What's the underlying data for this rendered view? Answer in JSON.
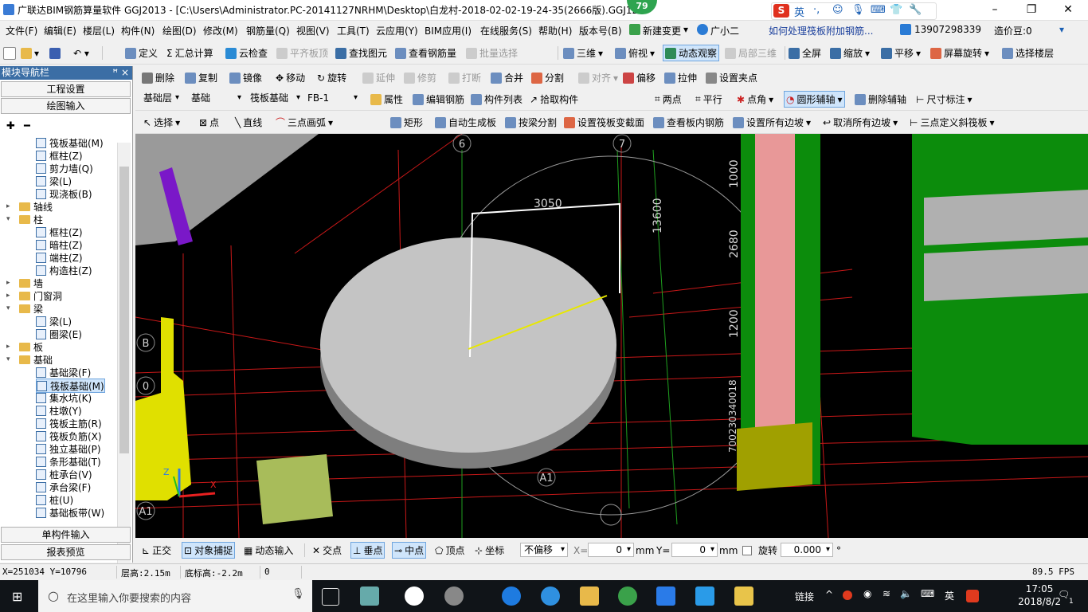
{
  "window": {
    "title": "广联达BIM钢筋算量软件 GGJ2013 - [C:\\Users\\Administrator.PC-20141127NRHM\\Desktop\\白龙村-2018-02-02-19-24-35(2666版).GGJ12",
    "badge": "79",
    "ime": {
      "lang": "英"
    }
  },
  "menu": [
    "文件(F)",
    "编辑(E)",
    "楼层(L)",
    "构件(N)",
    "绘图(D)",
    "修改(M)",
    "钢筋量(Q)",
    "视图(V)",
    "工具(T)",
    "云应用(Y)",
    "BIM应用(I)",
    "在线服务(S)",
    "帮助(H)",
    "版本号(B)",
    "新建变更",
    "广小二"
  ],
  "menu_right": {
    "question": "如何处理筏板附加钢筋...",
    "phone": "13907298339",
    "points": "造价豆:0"
  },
  "toolbar1": [
    "定义",
    "汇总计算",
    "云检查",
    "平齐板顶",
    "查找图元",
    "查看钢筋量",
    "批量选择",
    "三维",
    "俯视",
    "动态观察",
    "局部三维",
    "全屏",
    "缩放",
    "平移",
    "屏幕旋转",
    "选择楼层"
  ],
  "toolbar2": [
    "删除",
    "复制",
    "镜像",
    "移动",
    "旋转",
    "延伸",
    "修剪",
    "打断",
    "合并",
    "分割",
    "对齐",
    "偏移",
    "拉伸",
    "设置夹点"
  ],
  "toolbar3": {
    "floor_type": "基础层",
    "floor": "基础",
    "category": "筏板基础",
    "component": "FB-1",
    "buttons": [
      "属性",
      "编辑钢筋",
      "构件列表",
      "拾取构件"
    ],
    "snap_buttons": [
      "两点",
      "平行",
      "点角",
      "圆形辅轴",
      "删除辅轴",
      "尺寸标注"
    ]
  },
  "toolbar4": [
    "选择",
    "点",
    "直线",
    "三点画弧",
    "矩形",
    "自动生成板",
    "按梁分割",
    "设置筏板变截面",
    "查看板内钢筋",
    "设置所有边坡",
    "取消所有边坡",
    "三点定义斜筏板"
  ],
  "nav": {
    "header": "模块导航栏",
    "pin": "ꟸ ×",
    "top_buttons": [
      "工程设置",
      "绘图输入"
    ],
    "tree": [
      {
        "label": "筏板基础(M)",
        "level": 2
      },
      {
        "label": "框柱(Z)",
        "level": 2
      },
      {
        "label": "剪力墙(Q)",
        "level": 2
      },
      {
        "label": "梁(L)",
        "level": 2
      },
      {
        "label": "现浇板(B)",
        "level": 2
      },
      {
        "label": "轴线",
        "level": 1,
        "exp": "+"
      },
      {
        "label": "柱",
        "level": 1,
        "exp": "−"
      },
      {
        "label": "框柱(Z)",
        "level": 2
      },
      {
        "label": "暗柱(Z)",
        "level": 2
      },
      {
        "label": "端柱(Z)",
        "level": 2
      },
      {
        "label": "构造柱(Z)",
        "level": 2
      },
      {
        "label": "墙",
        "level": 1,
        "exp": "+"
      },
      {
        "label": "门窗洞",
        "level": 1,
        "exp": "+"
      },
      {
        "label": "梁",
        "level": 1,
        "exp": "−"
      },
      {
        "label": "梁(L)",
        "level": 2
      },
      {
        "label": "圈梁(E)",
        "level": 2
      },
      {
        "label": "板",
        "level": 1,
        "exp": "+"
      },
      {
        "label": "基础",
        "level": 1,
        "exp": "−"
      },
      {
        "label": "基础梁(F)",
        "level": 2
      },
      {
        "label": "筏板基础(M)",
        "level": 2,
        "selected": true
      },
      {
        "label": "集水坑(K)",
        "level": 2
      },
      {
        "label": "柱墩(Y)",
        "level": 2
      },
      {
        "label": "筏板主筋(R)",
        "level": 2
      },
      {
        "label": "筏板负筋(X)",
        "level": 2
      },
      {
        "label": "独立基础(P)",
        "level": 2
      },
      {
        "label": "条形基础(T)",
        "level": 2
      },
      {
        "label": "桩承台(V)",
        "level": 2
      },
      {
        "label": "承台梁(F)",
        "level": 2
      },
      {
        "label": "桩(U)",
        "level": 2
      },
      {
        "label": "基础板带(W)",
        "level": 2
      }
    ],
    "bottom_buttons": [
      "单构件输入",
      "报表预览"
    ]
  },
  "viewport": {
    "axis_labels": [
      "6",
      "7",
      "B",
      "0",
      "A1",
      "A1"
    ],
    "dims": [
      "3050",
      "13600",
      "1000",
      "2680",
      "1200",
      "700230340018"
    ]
  },
  "snapbar": {
    "buttons": [
      "正交",
      "对象捕捉",
      "动态输入",
      "交点",
      "垂点",
      "中点",
      "顶点",
      "坐标"
    ],
    "offset_mode": "不偏移",
    "x_label": "X=",
    "x_value": "0",
    "x_unit": "mm",
    "y_label": "Y=",
    "y_value": "0",
    "y_unit": "mm",
    "rotate_label": "旋转",
    "rotate_value": "0.000",
    "deg": "°"
  },
  "status": {
    "coords": "X=251034  Y=10796",
    "floor_height": "层高:2.15m",
    "bottom_height": "底标高:-2.2m",
    "extra": "0",
    "fps": "89.5 FPS"
  },
  "taskbar": {
    "search_placeholder": "在这里输入你要搜索的内容",
    "tray_text": "链接",
    "lang": "英",
    "time": "17:05",
    "date": "2018/8/2",
    "notifications": "1"
  },
  "colors": {
    "nav_header": "#3b6ea5",
    "viewport_bg": "#000000",
    "slab": "#c0c0c0",
    "grid": "#d01818",
    "accent": "#2ea44f"
  }
}
